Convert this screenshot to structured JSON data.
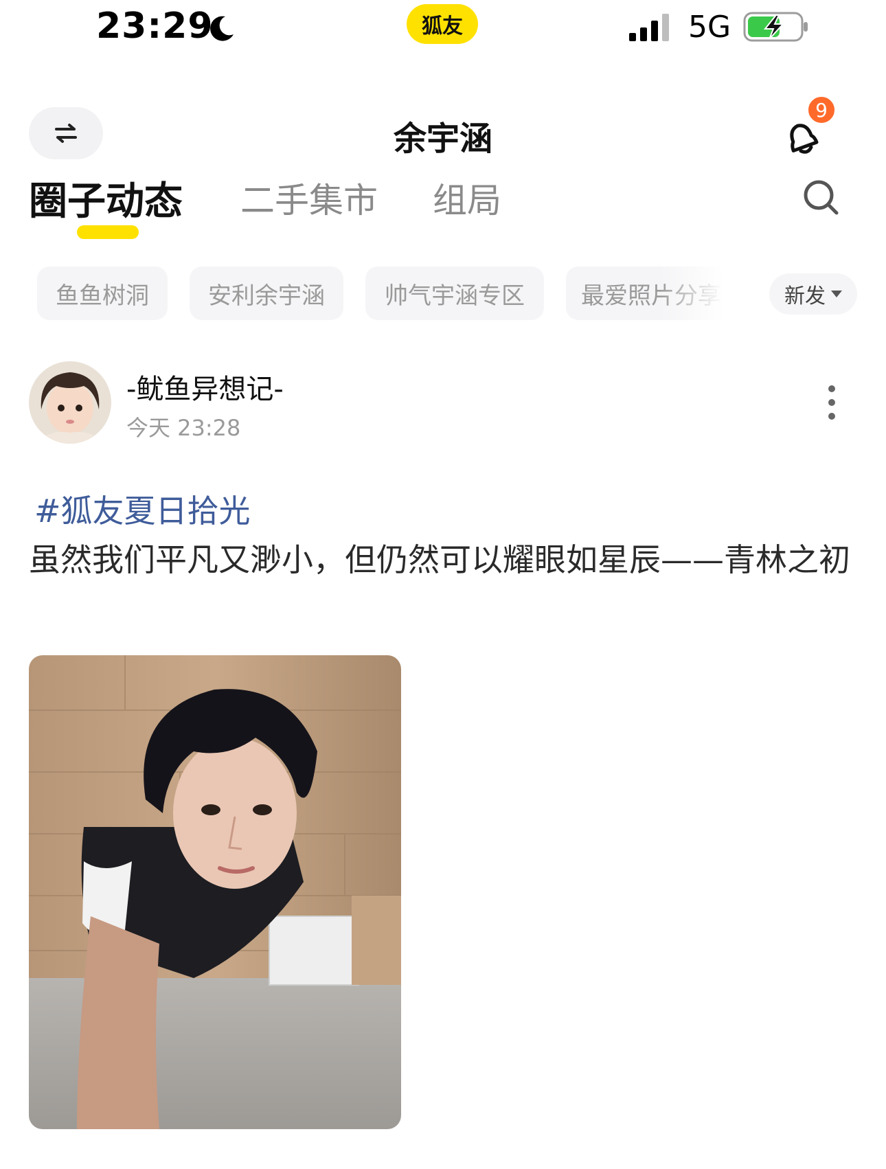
{
  "status_bar": {
    "time": "23:29",
    "app_name": "狐友",
    "network": "5G",
    "icons": [
      "moon-icon",
      "signal-icon",
      "battery-charging-icon"
    ]
  },
  "header": {
    "title": "余宇涵",
    "notification_count": "9",
    "icons": [
      "switch-arrows-icon",
      "bell-icon"
    ]
  },
  "tabs": [
    {
      "label": "圈子动态",
      "active": true
    },
    {
      "label": "二手集市",
      "active": false
    },
    {
      "label": "组局",
      "active": false
    }
  ],
  "chips": [
    "鱼鱼树洞",
    "安利余宇涵",
    "帅气宇涵专区",
    "最爱照片分享"
  ],
  "sort": {
    "label": "新发"
  },
  "post": {
    "author": "-鱿鱼异想记-",
    "time": "今天 23:28",
    "hashtag": "#狐友夏日拾光",
    "body": "虽然我们平凡又渺小，但仍然可以耀眼如星辰——青林之初"
  },
  "colors": {
    "accent": "#ffe100",
    "badge": "#ff6a2a",
    "hashtag": "#3f5c9a",
    "chip_bg": "#f5f5f7"
  }
}
